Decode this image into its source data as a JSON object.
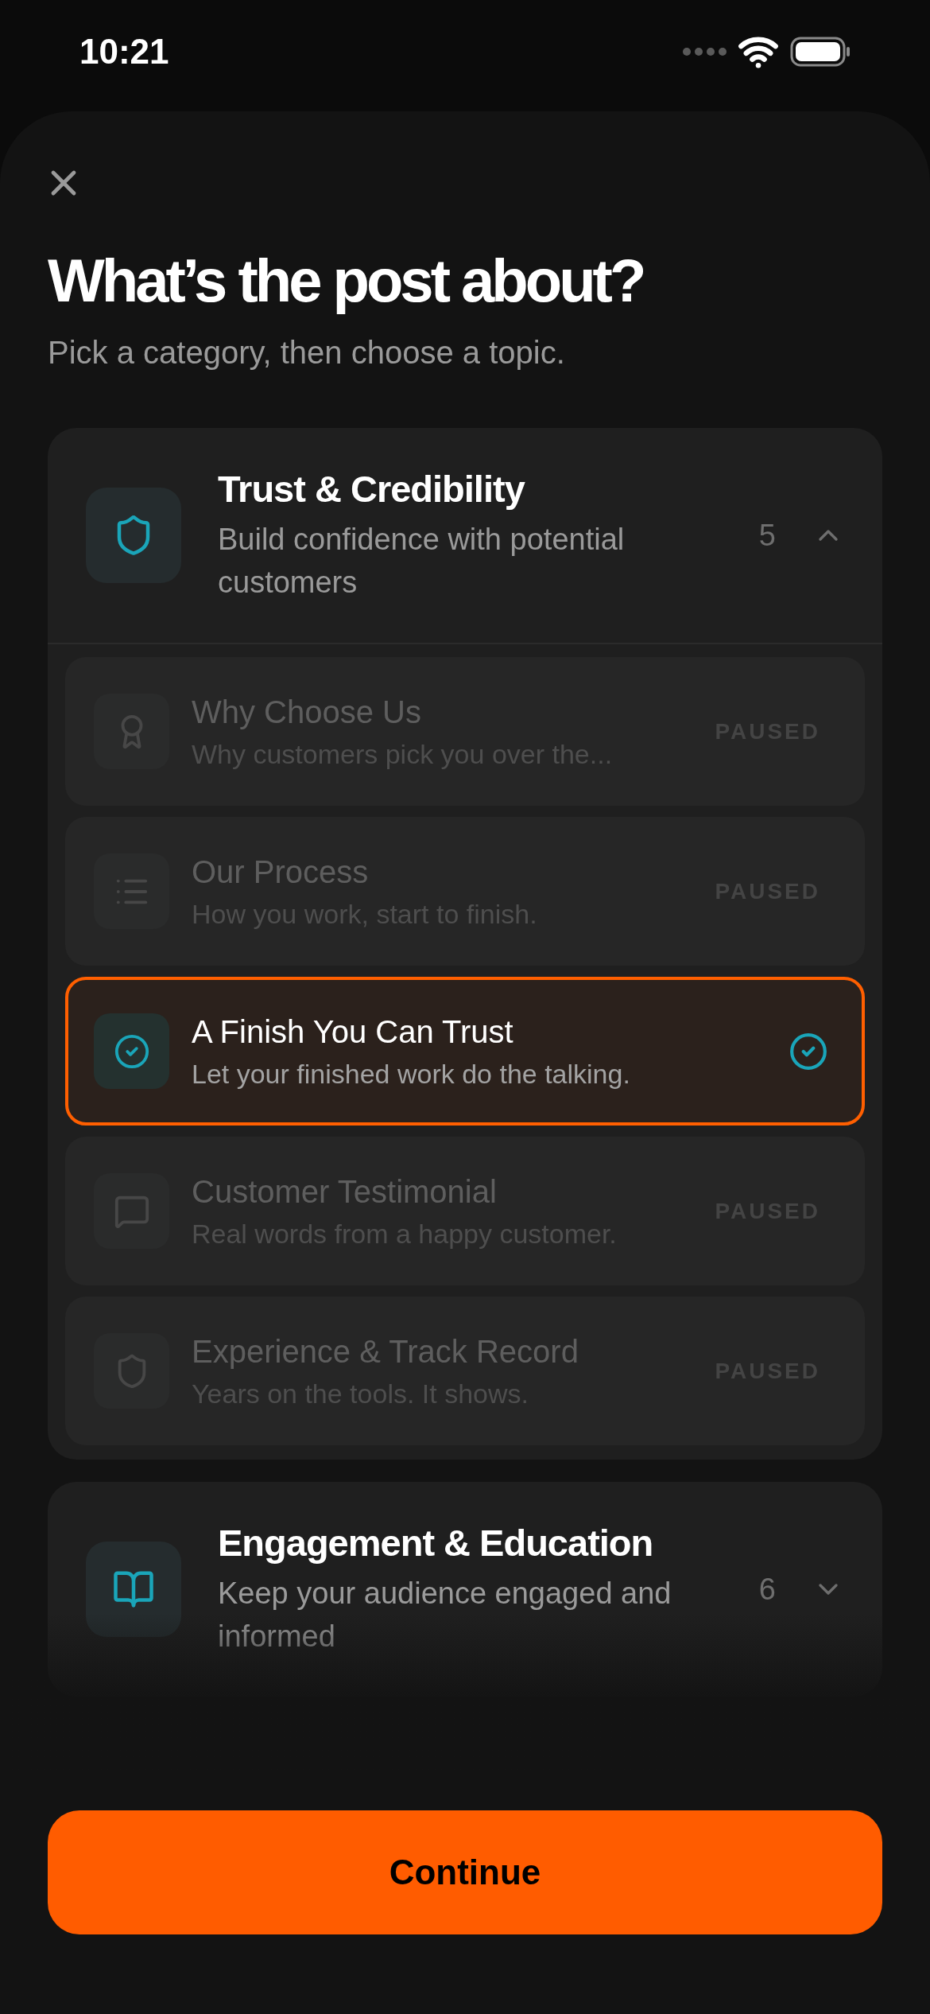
{
  "status_bar": {
    "time": "10:21"
  },
  "header": {
    "title": "What’s the post about?",
    "subtitle": "Pick a category, then choose a topic."
  },
  "categories": [
    {
      "title": "Trust & Credibility",
      "description": "Build confidence with potential customers",
      "count": "5",
      "kind": "shield",
      "expanded": true,
      "topics": [
        {
          "title": "Why Choose Us",
          "description": "Why customers pick you over the...",
          "kind": "award",
          "paused": true,
          "badge": "PAUSED",
          "selected": false
        },
        {
          "title": "Our Process",
          "description": "How you work, start to finish.",
          "kind": "list",
          "paused": true,
          "badge": "PAUSED",
          "selected": false
        },
        {
          "title": "A Finish You Can Trust",
          "description": "Let your finished work do the talking.",
          "kind": "check",
          "paused": false,
          "selected": true
        },
        {
          "title": "Customer Testimonial",
          "description": "Real words from a happy customer.",
          "kind": "message",
          "paused": true,
          "badge": "PAUSED",
          "selected": false
        },
        {
          "title": "Experience & Track Record",
          "description": "Years on the tools. It shows.",
          "kind": "shield",
          "paused": true,
          "badge": "PAUSED",
          "selected": false
        }
      ]
    },
    {
      "title": "Engagement & Education",
      "description": "Keep your audience engaged and informed",
      "count": "6",
      "kind": "book",
      "expanded": false
    }
  ],
  "continue_button": {
    "label": "Continue"
  }
}
